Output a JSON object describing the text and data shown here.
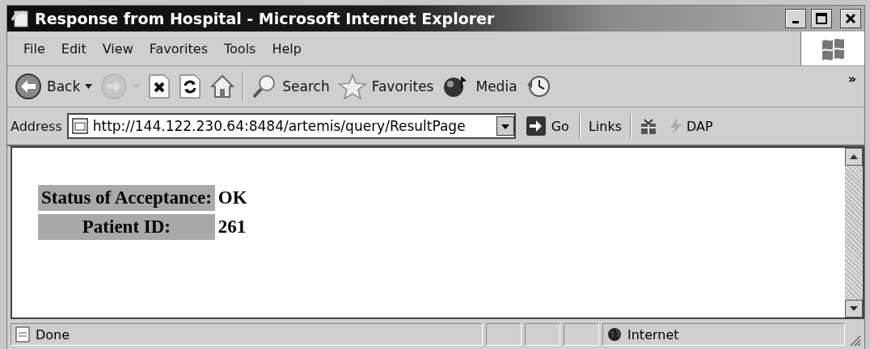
{
  "window": {
    "title": "Response from Hospital - Microsoft Internet Explorer"
  },
  "menu": [
    "File",
    "Edit",
    "View",
    "Favorites",
    "Tools",
    "Help"
  ],
  "toolbar": [
    {
      "kind": "back",
      "label": "Back",
      "disabled": false
    },
    {
      "kind": "forward",
      "disabled": true
    },
    {
      "kind": "stop",
      "disabled": false
    },
    {
      "kind": "refresh",
      "disabled": false
    },
    {
      "kind": "home",
      "disabled": false
    },
    {
      "kind": "search",
      "label": "Search",
      "disabled": false
    },
    {
      "kind": "favorites",
      "label": "Favorites",
      "disabled": false
    },
    {
      "kind": "media",
      "label": "Media",
      "disabled": false
    },
    {
      "kind": "history",
      "disabled": false
    }
  ],
  "toolbar_overflow": "»",
  "address": {
    "label": "Address",
    "value": "http://144.122.230.64:8484/artemis/query/ResultPage",
    "go": "Go"
  },
  "links": {
    "label": "Links",
    "items": [
      "DAP"
    ]
  },
  "page": {
    "rows": [
      {
        "label": "Status of Acceptance:",
        "value": "OK"
      },
      {
        "label": "Patient ID:",
        "value": "261"
      }
    ]
  },
  "status_bar": {
    "text": "Done",
    "zone": "Internet"
  }
}
